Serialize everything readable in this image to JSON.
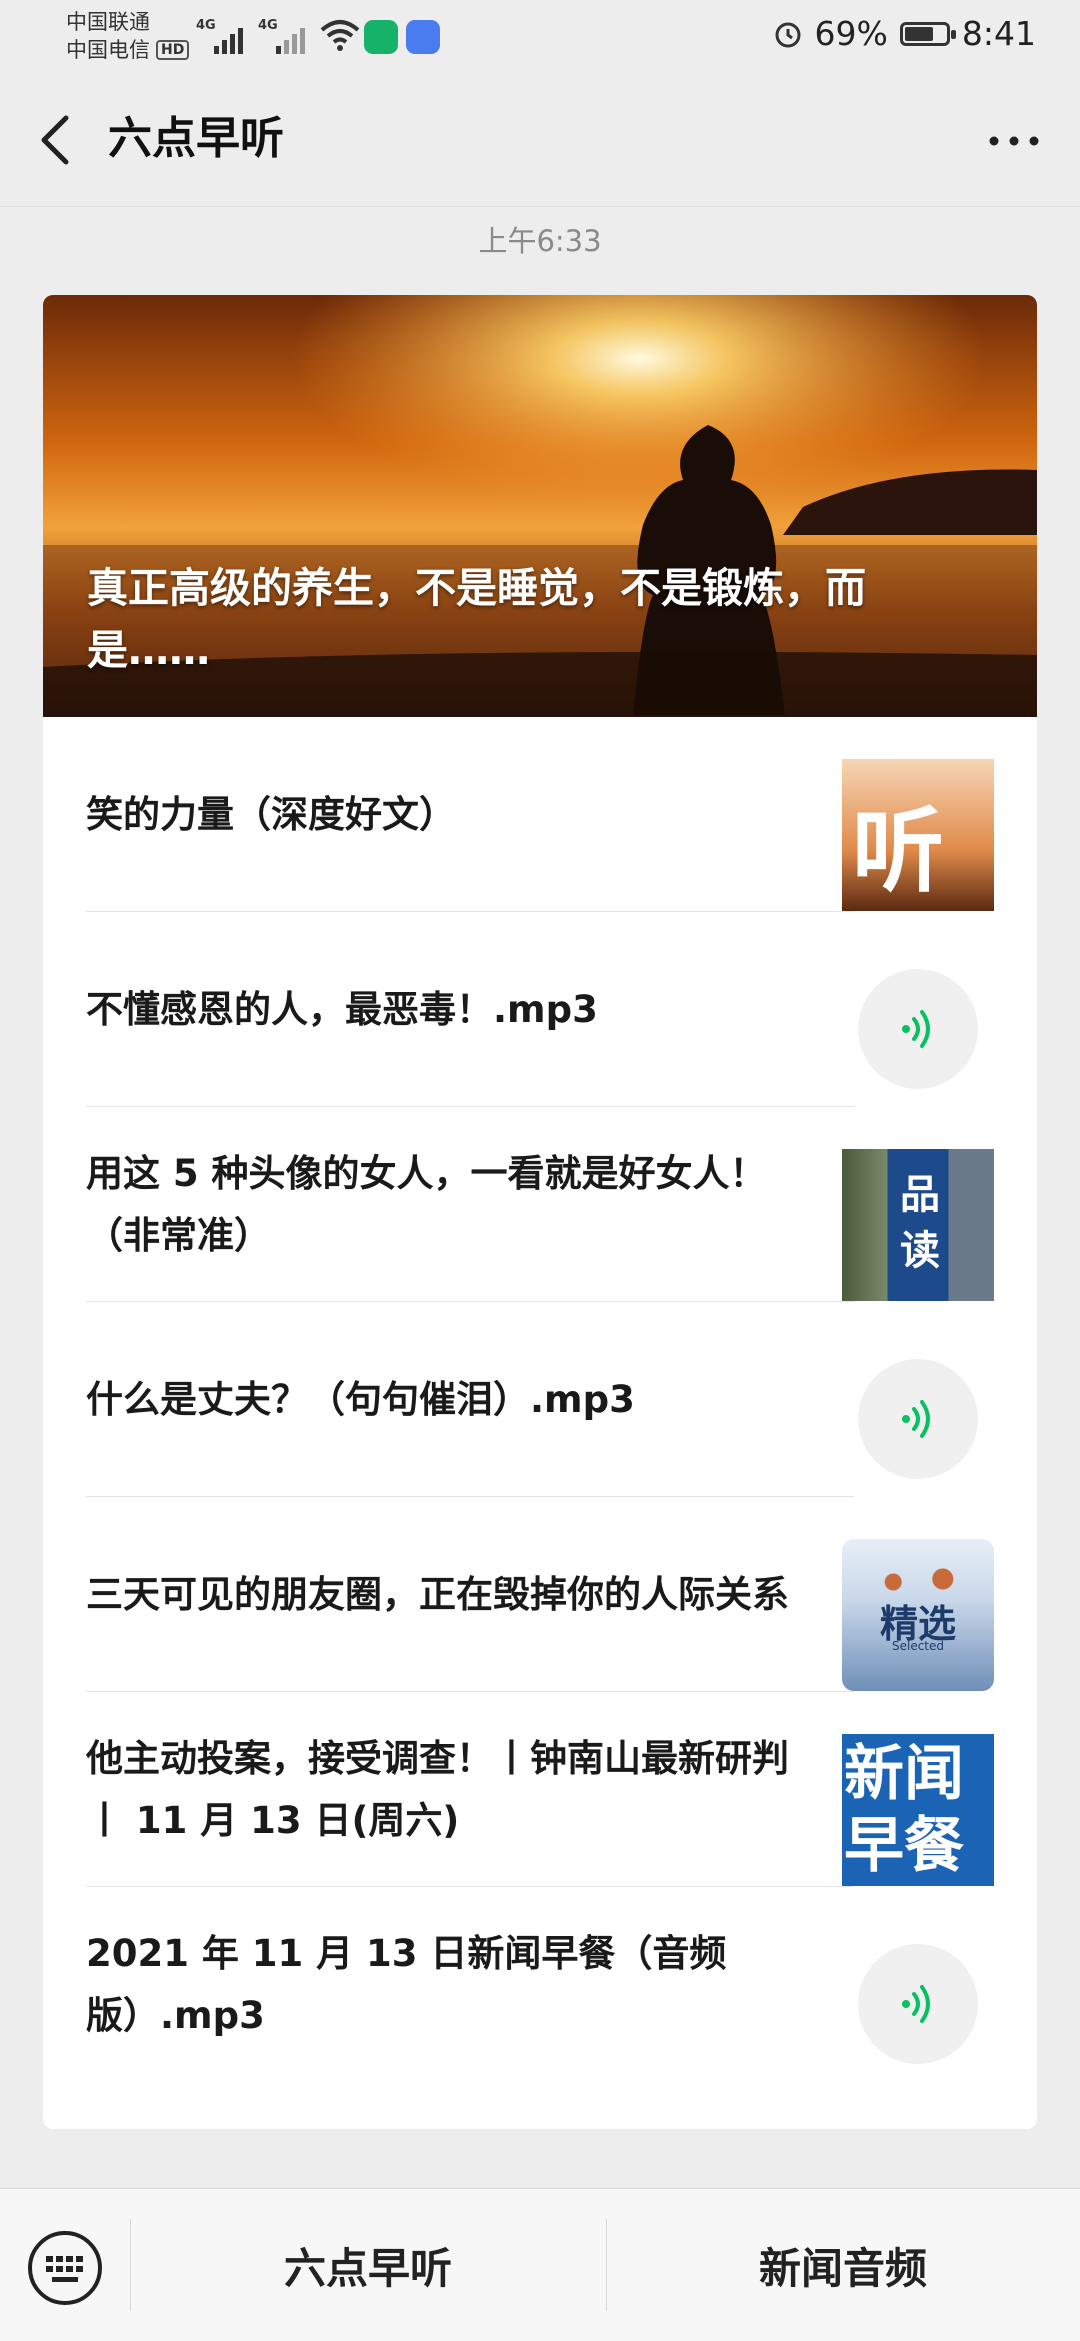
{
  "status": {
    "carrier1": "中国联通",
    "carrier2": "中国电信",
    "hd": "HD",
    "net1": "4G",
    "net2": "4G",
    "battery_pct": "69%",
    "battery_level": 0.69,
    "time": "8:41",
    "icons": [
      "signal-icon",
      "wifi-icon",
      "app-icon",
      "app-icon",
      "alarm-icon",
      "battery-icon"
    ]
  },
  "nav": {
    "title": "六点早听",
    "back_icon": "chevron-left-icon",
    "more_icon": "more-icon"
  },
  "timestamp": "上午6:33",
  "cover": {
    "title": "真正高级的养生，不是睡觉，不是锻炼，而是……"
  },
  "items": [
    {
      "title": "笑的力量（深度好文）",
      "kind": "thumb",
      "thumb_text": "听"
    },
    {
      "title": "不懂感恩的人，最恶毒！.mp3",
      "kind": "audio"
    },
    {
      "title": "用这 5 种头像的女人，一看就是好女人！（非常准）",
      "kind": "thumb",
      "thumb_text": "品读"
    },
    {
      "title": "什么是丈夫？（句句催泪）.mp3",
      "kind": "audio"
    },
    {
      "title": "三天可见的朋友圈，正在毁掉你的人际关系",
      "kind": "thumb",
      "thumb_text": "精选",
      "thumb_sub": "Selected"
    },
    {
      "title": "他主动投案，接受调查！丨钟南山最新研判丨 11 月 13 日(周六)",
      "kind": "thumb",
      "thumb_text": "新闻早餐"
    },
    {
      "title": "2021 年 11 月 13 日新闻早餐（音频版）.mp3",
      "kind": "audio"
    }
  ],
  "bottom": {
    "menu1": "六点早听",
    "menu2": "新闻音频",
    "keyboard_icon": "keyboard-icon"
  },
  "colors": {
    "accent": "#07c160",
    "background": "#ededed"
  }
}
